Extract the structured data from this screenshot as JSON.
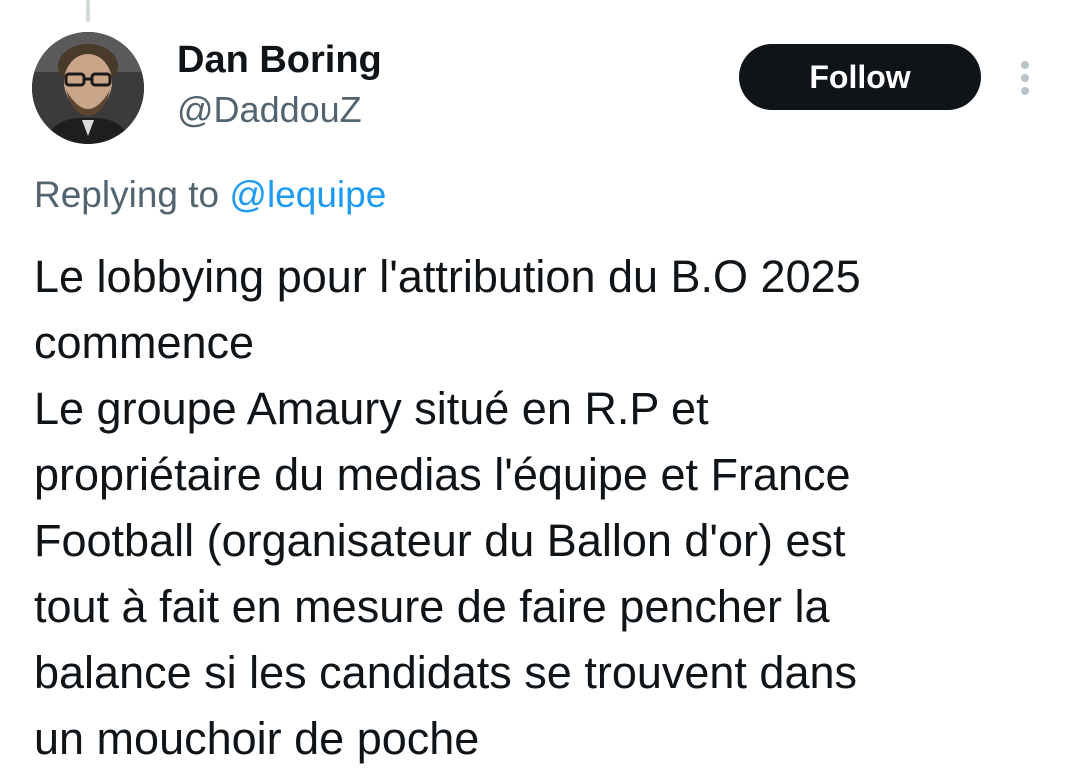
{
  "author": {
    "display_name": "Dan Boring",
    "handle": "@DaddouZ"
  },
  "follow_button": {
    "label": "Follow"
  },
  "reply": {
    "prefix": "Replying to",
    "mention": "@lequipe"
  },
  "tweet": {
    "lines": [
      "Le lobbying pour l'attribution du B.O 2025",
      "commence",
      "Le groupe Amaury situé en R.P et",
      "propriétaire du medias l'équipe et France",
      "Football (organisateur du Ballon d'or) est",
      "tout à fait en mesure de faire pencher la",
      "balance si les candidats se trouvent dans",
      "un mouchoir de poche"
    ]
  },
  "icons": {
    "more": "more-vertical-icon"
  },
  "colors": {
    "text_primary": "#0f1419",
    "text_secondary": "#536471",
    "link": "#1d9bf0",
    "button_bg": "#0f1419",
    "thread_line": "#cfd9de"
  }
}
